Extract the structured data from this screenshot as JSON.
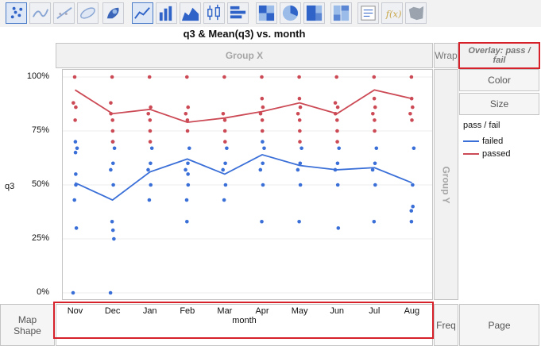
{
  "toolbar": {
    "buttons": [
      {
        "icon": "points-icon",
        "active": true
      },
      {
        "icon": "smoother-icon",
        "active": false
      },
      {
        "icon": "line-of-fit-icon",
        "active": false
      },
      {
        "icon": "ellipse-icon",
        "active": false
      },
      {
        "icon": "contour-icon",
        "active": false
      },
      {
        "icon": "line-icon",
        "active": true
      },
      {
        "icon": "bar-icon",
        "active": false
      },
      {
        "icon": "area-icon",
        "active": false
      },
      {
        "icon": "box-plot-icon",
        "active": false
      },
      {
        "icon": "histogram-icon",
        "active": false
      },
      {
        "icon": "heatmap-icon",
        "active": false
      },
      {
        "icon": "pie-icon",
        "active": false
      },
      {
        "icon": "treemap-icon",
        "active": false
      },
      {
        "icon": "mosaic-icon",
        "active": false
      },
      {
        "icon": "caption-box-icon",
        "active": false
      },
      {
        "icon": "formula-icon",
        "active": false
      },
      {
        "icon": "map-shapes-icon",
        "active": false
      }
    ]
  },
  "zones": {
    "group_x": "Group X",
    "wrap": "Wrap",
    "overlay": "Overlay: pass / fail",
    "color": "Color",
    "size": "Size",
    "group_y": "Group Y",
    "map_shape": "Map Shape",
    "freq": "Freq",
    "page": "Page"
  },
  "chart_data": {
    "type": "scatter",
    "title": "q3 & Mean(q3) vs. month",
    "xlabel": "month",
    "ylabel": "q3",
    "categories": [
      "Nov",
      "Dec",
      "Jan",
      "Feb",
      "Mar",
      "Apr",
      "May",
      "Jun",
      "Jul",
      "Aug"
    ],
    "y_ticks": [
      "0%",
      "25%",
      "50%",
      "75%",
      "100%"
    ],
    "ylim": [
      0,
      1
    ],
    "legend_title": "pass / fail",
    "legend_position": "right",
    "series": [
      {
        "name": "failed",
        "color": "#3a6fd8",
        "mean": [
          0.51,
          0.43,
          0.56,
          0.62,
          0.55,
          0.64,
          0.59,
          0.57,
          0.58,
          0.51
        ],
        "points": [
          [
            0,
            0.0
          ],
          [
            0,
            0.3
          ],
          [
            0,
            0.43
          ],
          [
            0,
            0.5
          ],
          [
            0,
            0.55
          ],
          [
            0,
            0.65
          ],
          [
            0,
            0.67
          ],
          [
            0,
            0.7
          ],
          [
            1,
            0.0
          ],
          [
            1,
            0.25
          ],
          [
            1,
            0.29
          ],
          [
            1,
            0.33
          ],
          [
            1,
            0.5
          ],
          [
            1,
            0.57
          ],
          [
            1,
            0.6
          ],
          [
            1,
            0.67
          ],
          [
            1,
            0.7
          ],
          [
            2,
            0.43
          ],
          [
            2,
            0.5
          ],
          [
            2,
            0.57
          ],
          [
            2,
            0.6
          ],
          [
            2,
            0.67
          ],
          [
            3,
            0.33
          ],
          [
            3,
            0.43
          ],
          [
            3,
            0.5
          ],
          [
            3,
            0.55
          ],
          [
            3,
            0.57
          ],
          [
            3,
            0.6
          ],
          [
            3,
            0.67
          ],
          [
            4,
            0.43
          ],
          [
            4,
            0.5
          ],
          [
            4,
            0.57
          ],
          [
            4,
            0.6
          ],
          [
            4,
            0.67
          ],
          [
            5,
            0.33
          ],
          [
            5,
            0.5
          ],
          [
            5,
            0.57
          ],
          [
            5,
            0.6
          ],
          [
            5,
            0.67
          ],
          [
            5,
            0.7
          ],
          [
            6,
            0.33
          ],
          [
            6,
            0.5
          ],
          [
            6,
            0.57
          ],
          [
            6,
            0.6
          ],
          [
            6,
            0.67
          ],
          [
            7,
            0.3
          ],
          [
            7,
            0.5
          ],
          [
            7,
            0.57
          ],
          [
            7,
            0.6
          ],
          [
            7,
            0.67
          ],
          [
            8,
            0.33
          ],
          [
            8,
            0.5
          ],
          [
            8,
            0.57
          ],
          [
            8,
            0.6
          ],
          [
            8,
            0.67
          ],
          [
            9,
            0.33
          ],
          [
            9,
            0.38
          ],
          [
            9,
            0.4
          ],
          [
            9,
            0.5
          ],
          [
            9,
            0.67
          ]
        ]
      },
      {
        "name": "passed",
        "color": "#cc4a55",
        "mean": [
          0.94,
          0.83,
          0.85,
          0.79,
          0.81,
          0.84,
          0.88,
          0.83,
          0.94,
          0.9
        ],
        "points": [
          [
            0,
            0.8
          ],
          [
            0,
            0.86
          ],
          [
            0,
            0.88
          ],
          [
            0,
            1.0
          ],
          [
            1,
            0.7
          ],
          [
            1,
            0.75
          ],
          [
            1,
            0.8
          ],
          [
            1,
            0.83
          ],
          [
            1,
            0.88
          ],
          [
            1,
            1.0
          ],
          [
            2,
            0.7
          ],
          [
            2,
            0.75
          ],
          [
            2,
            0.8
          ],
          [
            2,
            0.83
          ],
          [
            2,
            0.86
          ],
          [
            2,
            1.0
          ],
          [
            3,
            0.75
          ],
          [
            3,
            0.8
          ],
          [
            3,
            0.83
          ],
          [
            3,
            0.86
          ],
          [
            3,
            1.0
          ],
          [
            4,
            0.7
          ],
          [
            4,
            0.75
          ],
          [
            4,
            0.8
          ],
          [
            4,
            0.83
          ],
          [
            4,
            1.0
          ],
          [
            5,
            0.75
          ],
          [
            5,
            0.8
          ],
          [
            5,
            0.83
          ],
          [
            5,
            0.86
          ],
          [
            5,
            0.9
          ],
          [
            5,
            1.0
          ],
          [
            6,
            0.7
          ],
          [
            6,
            0.75
          ],
          [
            6,
            0.8
          ],
          [
            6,
            0.83
          ],
          [
            6,
            0.86
          ],
          [
            6,
            0.9
          ],
          [
            6,
            1.0
          ],
          [
            7,
            0.7
          ],
          [
            7,
            0.75
          ],
          [
            7,
            0.8
          ],
          [
            7,
            0.83
          ],
          [
            7,
            0.86
          ],
          [
            7,
            0.88
          ],
          [
            7,
            1.0
          ],
          [
            8,
            0.75
          ],
          [
            8,
            0.8
          ],
          [
            8,
            0.83
          ],
          [
            8,
            0.86
          ],
          [
            8,
            0.9
          ],
          [
            8,
            1.0
          ],
          [
            9,
            0.8
          ],
          [
            9,
            0.83
          ],
          [
            9,
            0.86
          ],
          [
            9,
            0.9
          ],
          [
            9,
            1.0
          ]
        ]
      }
    ]
  }
}
